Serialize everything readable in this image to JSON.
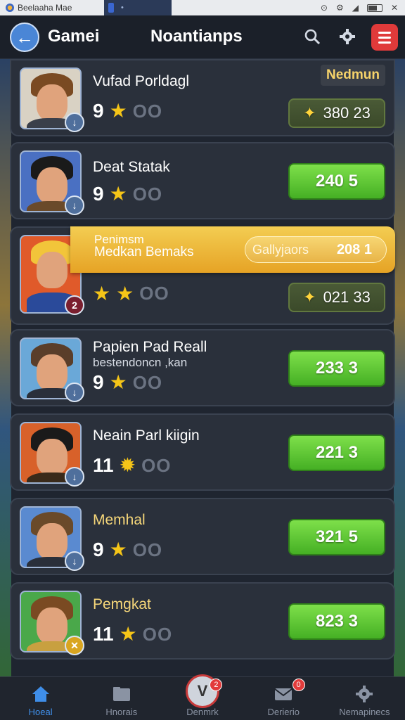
{
  "status_bar": {
    "app_name": "Beelaaha Mae",
    "tab_label": "•"
  },
  "header": {
    "title": "Gamei",
    "subtitle": "Noantianps",
    "menu_color": "#e03a3a"
  },
  "players": [
    {
      "name": "Vufad Porldagl",
      "subname": "",
      "level": "9",
      "rank": "OO",
      "score": "380 23",
      "tag": "Nedmun",
      "button_style": "dark",
      "badge": "↓"
    },
    {
      "name": "Deat Statak",
      "subname": "",
      "level": "9",
      "rank": "OO",
      "score": "240 5",
      "tag": "",
      "button_style": "green",
      "badge": "↓"
    },
    {
      "name": "Penimsm",
      "subname": "Medkan Bemaks",
      "level": "",
      "rank": "OO",
      "score": "021 33",
      "tag": "",
      "button_style": "dark",
      "badge": "2",
      "highlight": {
        "pill_label": "Gallyjaors",
        "pill_value": "208 1"
      }
    },
    {
      "name": "Papien Pad Reall",
      "subname": "bestendoncn ,kan",
      "level": "9",
      "rank": "OO",
      "score": "233 3",
      "tag": "",
      "button_style": "green",
      "badge": "↓"
    },
    {
      "name": "Neain Parl kiigin",
      "subname": "",
      "level": "11",
      "rank": "OO",
      "score": "221 3",
      "tag": "",
      "button_style": "green",
      "badge": "↓"
    },
    {
      "name": "Memhal",
      "subname": "",
      "level": "9",
      "rank": "OO",
      "score": "321 5",
      "tag": "",
      "button_style": "green",
      "badge": "↓"
    },
    {
      "name": "Pemgkat",
      "subname": "",
      "level": "11",
      "rank": "OO",
      "score": "823 3",
      "tag": "",
      "button_style": "green",
      "badge": "✕"
    }
  ],
  "bottom_nav": [
    {
      "label": "Hoeal",
      "icon": "home-icon",
      "active": true
    },
    {
      "label": "Hnorais",
      "icon": "folder-icon",
      "active": false
    },
    {
      "label": "Denmrk",
      "icon": "v-logo-icon",
      "active": false,
      "badge": "2"
    },
    {
      "label": "Derierio",
      "icon": "mail-icon",
      "active": false,
      "badge": "0"
    },
    {
      "label": "Nemapinecs",
      "icon": "settings-icon",
      "active": false
    }
  ]
}
